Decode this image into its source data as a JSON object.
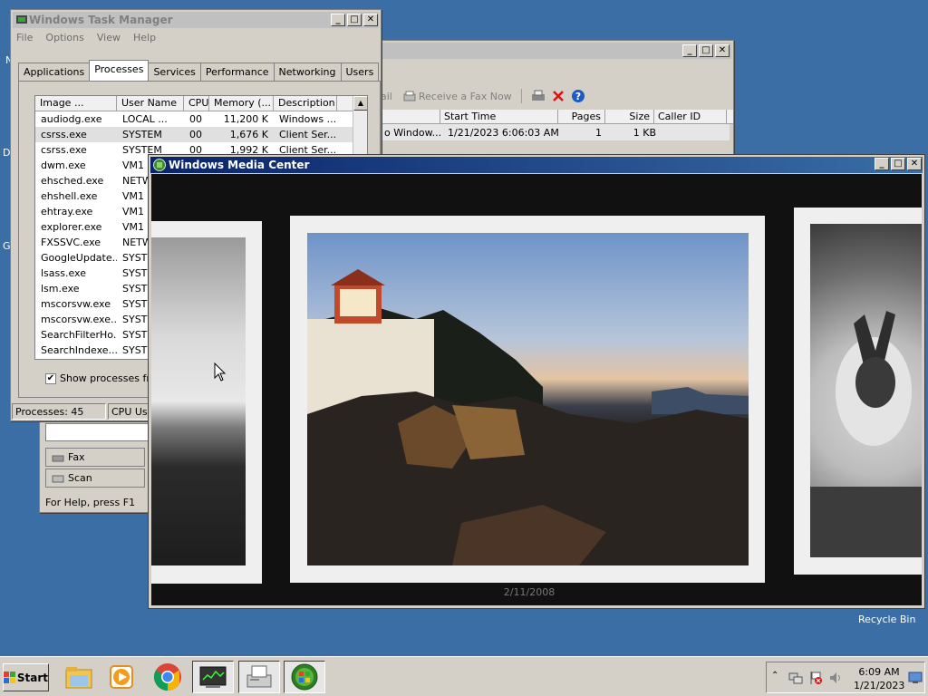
{
  "desktop": {
    "edge_glyphs": [
      "N",
      "D",
      "G"
    ],
    "recycle_bin_label": "Recycle Bin"
  },
  "task_manager": {
    "title": "Windows Task Manager",
    "menu": [
      "File",
      "Options",
      "View",
      "Help"
    ],
    "tabs": [
      "Applications",
      "Processes",
      "Services",
      "Performance",
      "Networking",
      "Users"
    ],
    "selected_tab": "Processes",
    "columns": [
      "Image ...",
      "User Name",
      "CPU",
      "Memory (...",
      "Description"
    ],
    "rows": [
      {
        "image": "audiodg.exe",
        "user": "LOCAL ...",
        "cpu": "00",
        "mem": "11,200 K",
        "desc": "Windows ..."
      },
      {
        "image": "csrss.exe",
        "user": "SYSTEM",
        "cpu": "00",
        "mem": "1,676 K",
        "desc": "Client Ser..."
      },
      {
        "image": "csrss.exe",
        "user": "SYSTEM",
        "cpu": "00",
        "mem": "1,992 K",
        "desc": "Client Ser..."
      },
      {
        "image": "dwm.exe",
        "user": "VM1",
        "cpu": "",
        "mem": "",
        "desc": ""
      },
      {
        "image": "ehsched.exe",
        "user": "NETW",
        "cpu": "",
        "mem": "",
        "desc": ""
      },
      {
        "image": "ehshell.exe",
        "user": "VM1",
        "cpu": "",
        "mem": "",
        "desc": ""
      },
      {
        "image": "ehtray.exe",
        "user": "VM1",
        "cpu": "",
        "mem": "",
        "desc": ""
      },
      {
        "image": "explorer.exe",
        "user": "VM1",
        "cpu": "",
        "mem": "",
        "desc": ""
      },
      {
        "image": "FXSSVC.exe",
        "user": "NETW",
        "cpu": "",
        "mem": "",
        "desc": ""
      },
      {
        "image": "GoogleUpdate...",
        "user": "SYSTE",
        "cpu": "",
        "mem": "",
        "desc": ""
      },
      {
        "image": "lsass.exe",
        "user": "SYSTE",
        "cpu": "",
        "mem": "",
        "desc": ""
      },
      {
        "image": "lsm.exe",
        "user": "SYSTE",
        "cpu": "",
        "mem": "",
        "desc": ""
      },
      {
        "image": "mscorsvw.exe",
        "user": "SYSTE",
        "cpu": "",
        "mem": "",
        "desc": ""
      },
      {
        "image": "mscorsvw.exe...",
        "user": "SYSTE",
        "cpu": "",
        "mem": "",
        "desc": ""
      },
      {
        "image": "SearchFilterHo...",
        "user": "SYSTE",
        "cpu": "",
        "mem": "",
        "desc": ""
      },
      {
        "image": "SearchIndexe...",
        "user": "SYSTE",
        "cpu": "",
        "mem": "",
        "desc": ""
      }
    ],
    "show_all_label": "Show processes from a",
    "status_processes": "Processes: 45",
    "status_cpu": "CPU Usa"
  },
  "fax": {
    "toolbar_fragment": "ail",
    "receive_label": "Receive a Fax Now",
    "columns": [
      "Start Time",
      "Pages",
      "Size",
      "Caller ID"
    ],
    "row": {
      "from": "o Window...",
      "start": "1/21/2023 6:06:03 AM",
      "pages": "1",
      "size": "1 KB"
    },
    "nav_fax": "Fax",
    "nav_scan": "Scan",
    "status": "For Help, press F1"
  },
  "media_center": {
    "title": "Windows Media Center",
    "photo_date": "2/11/2008"
  },
  "taskbar": {
    "start_label": "Start",
    "time": "6:09 AM",
    "date": "1/21/2023",
    "pinned": [
      "explorer-icon",
      "media-player-icon",
      "chrome-icon",
      "task-manager-icon",
      "fax-icon",
      "media-center-icon"
    ]
  }
}
